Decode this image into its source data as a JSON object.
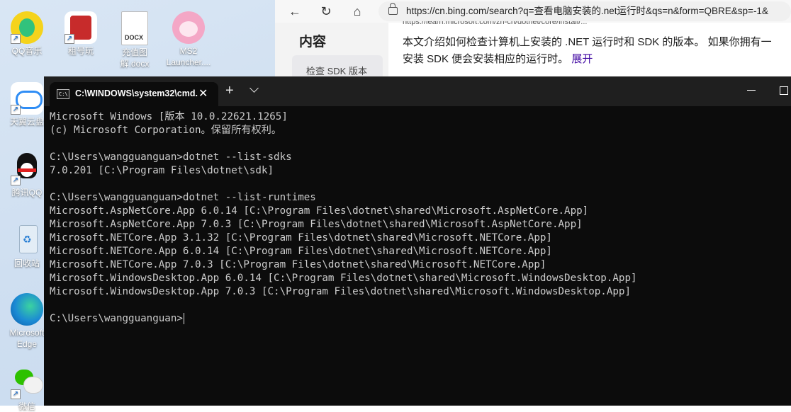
{
  "desktop": {
    "icons": [
      {
        "label": "QQ音乐",
        "icon": "qq-music-icon",
        "color": "#31c27c"
      },
      {
        "label": "租号玩",
        "icon": "zuhaowan-icon",
        "color": "#d02b2b"
      },
      {
        "label": "充值图解.docx",
        "icon": "docx-file-icon",
        "color": "#ffffff"
      },
      {
        "label": "MS2 Launcher....",
        "icon": "ms2-launcher-icon",
        "color": "#f4a7c6"
      },
      {
        "label": "天翼云盘",
        "icon": "cloud-drive-icon",
        "color": "#2f8df5"
      },
      {
        "label": "腾讯QQ",
        "icon": "qq-penguin-icon",
        "color": "#111111"
      },
      {
        "label": "回收站",
        "icon": "recycle-bin-icon",
        "color": "#e3edf6"
      },
      {
        "label": "Microsoft Edge",
        "icon": "edge-icon",
        "color": "#1b8ad4"
      },
      {
        "label": "微信",
        "icon": "wechat-icon",
        "color": "#2dc100"
      }
    ]
  },
  "browser": {
    "url": "https://cn.bing.com/search?q=查看电脑安装的.net运行时&qs=n&form=QBRE&sp=-1&",
    "toc_title": "内容",
    "toc_item": "检查 SDK 版本",
    "cut_url": "https://learn.microsoft.com/zh-cn/dotnet/core/install/...",
    "summary_line1": "本文介绍如何检查计算机上安装的 .NET 运行时和 SDK 的版本。 如果你拥有一",
    "summary_line2": "安装 SDK 便会安装相应的运行时。",
    "expand": "展开"
  },
  "terminal": {
    "tab_title": "C:\\WINDOWS\\system32\\cmd.",
    "tab_close": "✕",
    "new_tab": "+",
    "lines": [
      "Microsoft Windows [版本 10.0.22621.1265]",
      "(c) Microsoft Corporation。保留所有权利。",
      "",
      "C:\\Users\\wangguanguan>dotnet --list-sdks",
      "7.0.201 [C:\\Program Files\\dotnet\\sdk]",
      "",
      "C:\\Users\\wangguanguan>dotnet --list-runtimes",
      "Microsoft.AspNetCore.App 6.0.14 [C:\\Program Files\\dotnet\\shared\\Microsoft.AspNetCore.App]",
      "Microsoft.AspNetCore.App 7.0.3 [C:\\Program Files\\dotnet\\shared\\Microsoft.AspNetCore.App]",
      "Microsoft.NETCore.App 3.1.32 [C:\\Program Files\\dotnet\\shared\\Microsoft.NETCore.App]",
      "Microsoft.NETCore.App 6.0.14 [C:\\Program Files\\dotnet\\shared\\Microsoft.NETCore.App]",
      "Microsoft.NETCore.App 7.0.3 [C:\\Program Files\\dotnet\\shared\\Microsoft.NETCore.App]",
      "Microsoft.WindowsDesktop.App 6.0.14 [C:\\Program Files\\dotnet\\shared\\Microsoft.WindowsDesktop.App]",
      "Microsoft.WindowsDesktop.App 7.0.3 [C:\\Program Files\\dotnet\\shared\\Microsoft.WindowsDesktop.App]",
      "",
      "C:\\Users\\wangguanguan>"
    ]
  }
}
